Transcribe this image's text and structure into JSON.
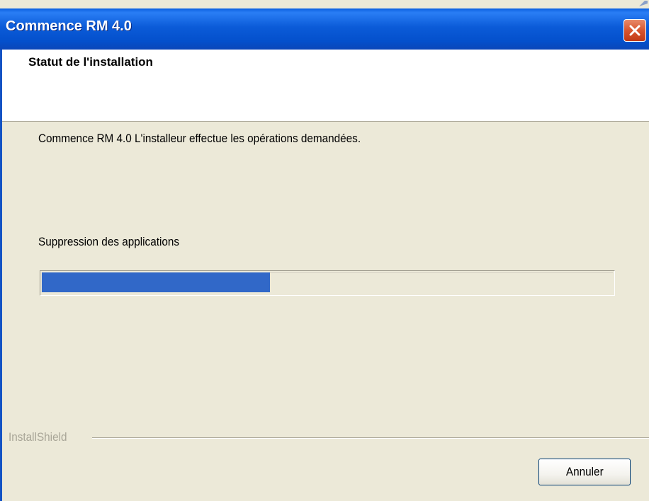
{
  "window": {
    "title": "Commence RM 4.0"
  },
  "header": {
    "title": "Statut de l'installation"
  },
  "main": {
    "status_text": "Commence RM 4.0 L'installeur effectue les opérations demandées.",
    "action_text": "Suppression des applications",
    "progress_fraction": 0.4
  },
  "footer": {
    "brand": "InstallShield",
    "cancel_label": "Annuler"
  },
  "colors": {
    "titlebar": "#0b5bd8",
    "progress_fill": "#3168c8",
    "dialog_background": "#ece9d8",
    "close_button": "#d8552e"
  },
  "icons": {
    "close": "close-icon",
    "corner": "window-corner-icon"
  }
}
